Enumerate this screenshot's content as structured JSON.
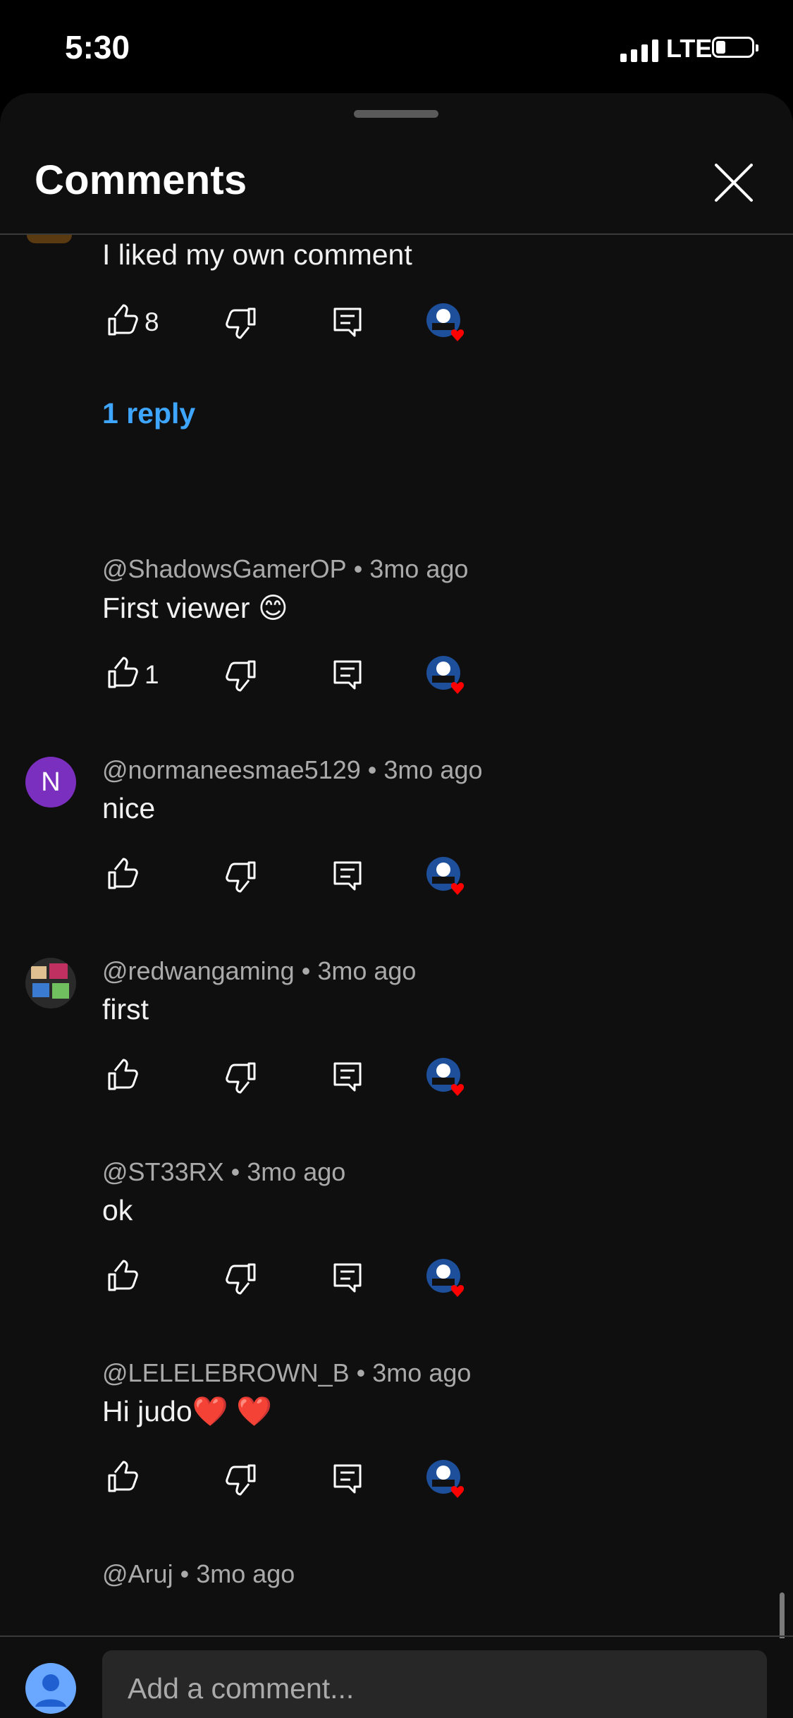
{
  "status_bar": {
    "time": "5:30",
    "network": "LTE"
  },
  "header": {
    "title": "Comments",
    "close_icon": "close-icon"
  },
  "comments": [
    {
      "text": "I liked my own comment",
      "likes": "8",
      "replies_label": "1 reply"
    },
    {
      "author": "@ShadowsGamerOP",
      "age": "3mo ago",
      "text": "First viewer 😊",
      "likes": "1"
    },
    {
      "author": "@normaneesmae5129",
      "age": "3mo ago",
      "text": "nice",
      "likes": "",
      "avatar_letter": "N",
      "avatar_color": "#7b2fbf"
    },
    {
      "author": "@redwangaming",
      "age": "3mo ago",
      "text": "first",
      "likes": ""
    },
    {
      "author": "@ST33RX",
      "age": "3mo ago",
      "text": "ok",
      "likes": ""
    },
    {
      "author": "@LELELEBROWN_B",
      "age": "3mo ago",
      "text": "Hi judo❤️ ❤️",
      "likes": ""
    },
    {
      "author": "@Aruj",
      "age": "3mo ago"
    }
  ],
  "composer": {
    "placeholder": "Add a comment..."
  },
  "colors": {
    "background": "#0f0f0f",
    "link": "#3ea6ff",
    "meta": "#aaaaaa",
    "input_bg": "#272727"
  }
}
